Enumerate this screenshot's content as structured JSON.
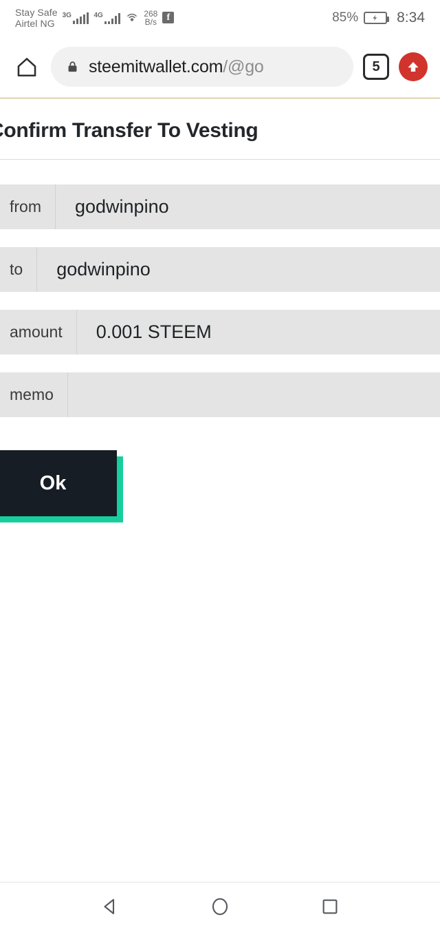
{
  "status_bar": {
    "carrier_line1": "Stay Safe",
    "carrier_line2": "Airtel NG",
    "network_1_label": "3G",
    "network_2_label": "4G",
    "data_rate_value": "268",
    "data_rate_unit": "B/s",
    "hotspot_icon": "hotspot-icon",
    "facebook_icon": "facebook-icon",
    "battery_percent": "85%",
    "battery_icon": "battery-charging-icon",
    "time": "8:34"
  },
  "browser": {
    "home_icon": "home-icon",
    "lock_icon": "lock-icon",
    "url_visible": "steemitwallet.com",
    "url_path": "/@go",
    "tab_count": "5",
    "upload_icon": "upload-arrow-icon"
  },
  "page": {
    "title": "Confirm Transfer To Vesting",
    "fields": [
      {
        "label": "from",
        "value": "godwinpino"
      },
      {
        "label": "to",
        "value": "godwinpino"
      },
      {
        "label": "amount",
        "value": "0.001 STEEM"
      },
      {
        "label": "memo",
        "value": ""
      }
    ],
    "confirm_button": "Ok"
  },
  "nav_bar": {
    "back_icon": "back-triangle-icon",
    "home_icon": "home-circle-icon",
    "recents_icon": "recents-square-icon"
  },
  "colors": {
    "accent_teal": "#17cf9d",
    "button_dark": "#171d25",
    "field_gray": "#e4e4e4",
    "upload_red": "#d0342c",
    "url_divider_gold": "#c8ab6b"
  }
}
